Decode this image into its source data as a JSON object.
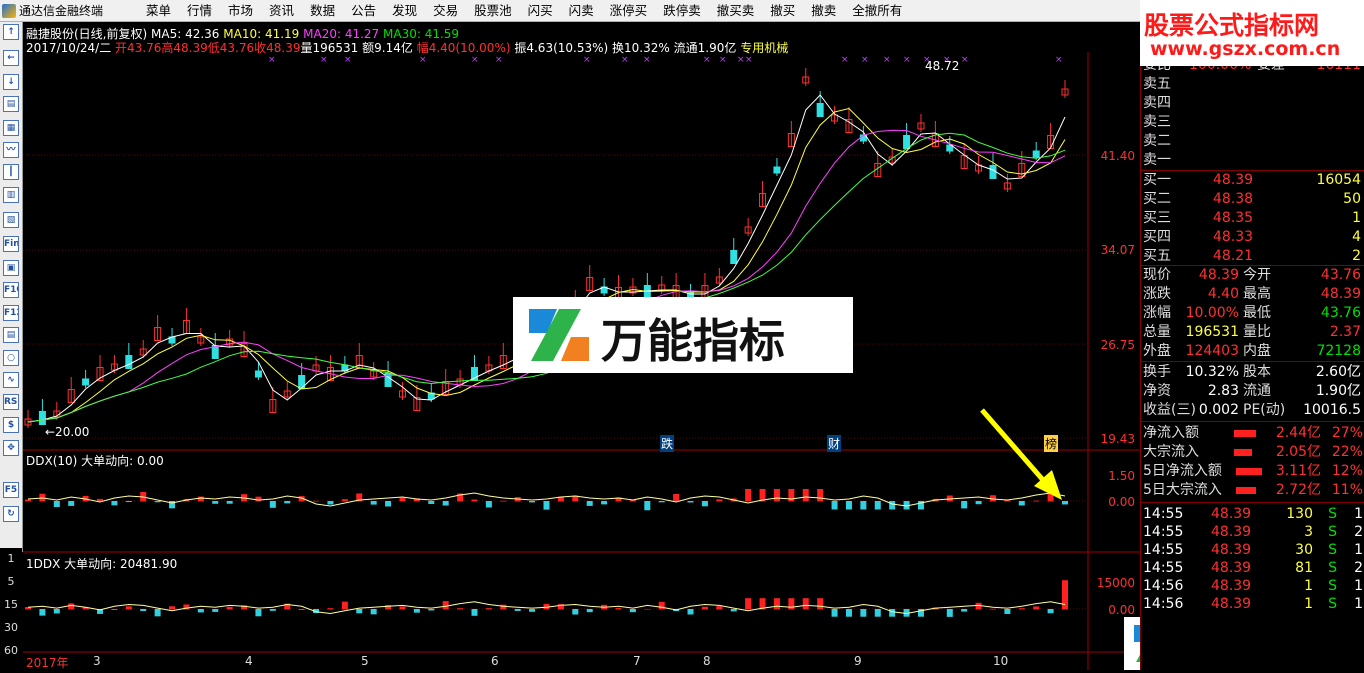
{
  "window": {
    "title": "通达信金融终端"
  },
  "menu": [
    "菜单",
    "行情",
    "市场",
    "资讯",
    "数据",
    "公告",
    "发现",
    "交易",
    "股票池",
    "闪买",
    "闪卖",
    "涨停买",
    "跌停卖",
    "撤买卖",
    "撤买",
    "撤卖",
    "全撤所有"
  ],
  "toolbar": {
    "buttons": [
      "Fin",
      "F10",
      "F12",
      "RSI",
      "F5"
    ]
  },
  "periods": [
    "1",
    "5",
    "15",
    "30",
    "60"
  ],
  "watermark": {
    "title": "股票公式指标网",
    "url": "www.gszx.com.cn"
  },
  "logo_text": "万能指标",
  "stock": {
    "name_line": "融捷股份(日线,前复权)",
    "ma5": "MA5: 42.36",
    "ma10": "MA10: 41.19",
    "ma20": "MA20: 41.27",
    "ma30": "MA30: 41.59",
    "date": "2017/10/24/二",
    "open": "开43.76",
    "high": "高48.39",
    "low": "低43.76",
    "close": "收48.39",
    "vol": "量196531",
    "amount": "额9.14亿",
    "change": "幅4.40(10.00%)",
    "amp": "振4.63(10.53%)",
    "turnover": "换10.32%",
    "float": "流通1.90亿",
    "industry": "专用机械"
  },
  "price_axis": [
    "41.40",
    "34.07",
    "26.75",
    "19.43"
  ],
  "annotations": {
    "high": "48.72",
    "low": "←20.00",
    "tag_fall": "跌",
    "tag_fin": "财",
    "tag_list": "榜"
  },
  "ddx": {
    "title": "DDX(10)  大单动向: 0.00",
    "axis": [
      "1.50",
      "0.00"
    ]
  },
  "ddx2": {
    "title": "1DDX  大单动向: 20481.90",
    "axis": [
      "15000",
      "0.00"
    ]
  },
  "months": [
    "2017年",
    "3",
    "4",
    "5",
    "6",
    "7",
    "8",
    "9",
    "10"
  ],
  "panel": {
    "weibi": {
      "l": "委比",
      "v": "100.00%",
      "l2": "委差",
      "v2": "16111"
    },
    "sells": [
      {
        "l": "卖五"
      },
      {
        "l": "卖四"
      },
      {
        "l": "卖三"
      },
      {
        "l": "卖二"
      },
      {
        "l": "卖一"
      }
    ],
    "buys": [
      {
        "l": "买一",
        "p": "48.39",
        "v": "16054"
      },
      {
        "l": "买二",
        "p": "48.38",
        "v": "50"
      },
      {
        "l": "买三",
        "p": "48.35",
        "v": "1"
      },
      {
        "l": "买四",
        "p": "48.33",
        "v": "4"
      },
      {
        "l": "买五",
        "p": "48.21",
        "v": "2"
      }
    ],
    "quotes": [
      {
        "l": "现价",
        "v": "48.39",
        "l2": "今开",
        "v2": "43.76"
      },
      {
        "l": "涨跌",
        "v": "4.40",
        "l2": "最高",
        "v2": "48.39"
      },
      {
        "l": "涨幅",
        "v": "10.00%",
        "l2": "最低",
        "v2": "43.76"
      },
      {
        "l": "总量",
        "v": "196531",
        "l2": "量比",
        "v2": "2.37"
      },
      {
        "l": "外盘",
        "v": "124403",
        "l2": "内盘",
        "v2": "72128"
      }
    ],
    "fund": [
      {
        "l": "换手",
        "v": "10.32%",
        "l2": "股本",
        "v2": "2.60亿"
      },
      {
        "l": "净资",
        "v": "2.83",
        "l2": "流通",
        "v2": "1.90亿"
      },
      {
        "l": "收益(三)",
        "v": "0.002",
        "l2": "PE(动)",
        "v2": "10016.5"
      }
    ],
    "flows": [
      {
        "l": "净流入额",
        "v": "2.44亿",
        "p": "27%"
      },
      {
        "l": "大宗流入",
        "v": "2.05亿",
        "p": "22%"
      },
      {
        "l": "5日净流入额",
        "v": "3.11亿",
        "p": "12%"
      },
      {
        "l": "5日大宗流入",
        "v": "2.72亿",
        "p": "11%"
      }
    ],
    "ticks": [
      {
        "t": "14:55",
        "p": "48.39",
        "v": "130",
        "s": "S",
        "n": "1"
      },
      {
        "t": "14:55",
        "p": "48.39",
        "v": "3",
        "s": "S",
        "n": "2"
      },
      {
        "t": "14:55",
        "p": "48.39",
        "v": "30",
        "s": "S",
        "n": "1"
      },
      {
        "t": "14:55",
        "p": "48.39",
        "v": "81",
        "s": "S",
        "n": "2"
      },
      {
        "t": "14:56",
        "p": "48.39",
        "v": "1",
        "s": "S",
        "n": "1"
      },
      {
        "t": "14:56",
        "p": "48.39",
        "v": "1",
        "s": "S",
        "n": "1"
      }
    ]
  }
}
